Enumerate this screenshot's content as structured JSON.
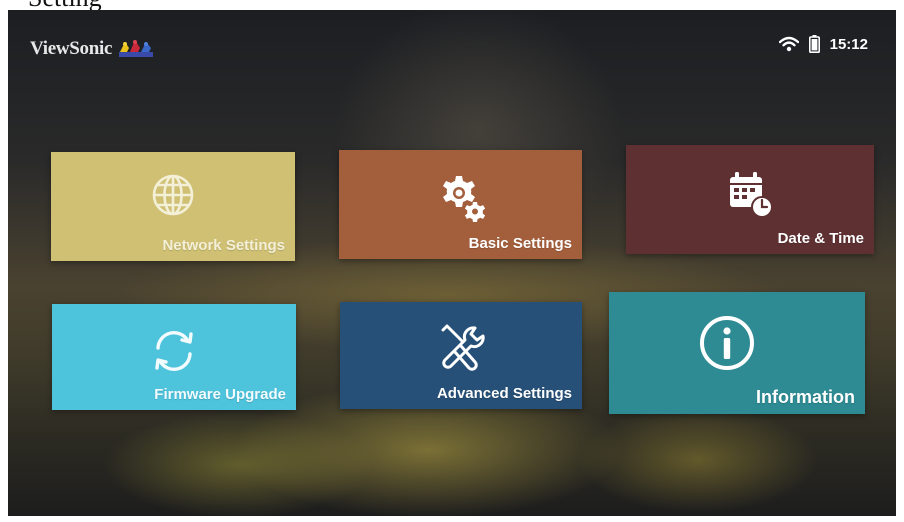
{
  "caption": "Setting",
  "brand": {
    "name": "ViewSonic",
    "logo_icon": "three-birds-logo-icon"
  },
  "status_bar": {
    "wifi_icon": "wifi-icon",
    "battery_icon": "battery-icon",
    "time": "15:12"
  },
  "tiles": [
    {
      "label": "Network Settings",
      "icon": "globe-icon",
      "color": "#cfc074"
    },
    {
      "label": "Basic Settings",
      "icon": "gear-icon",
      "color": "#a35f3c"
    },
    {
      "label": "Date & Time",
      "icon": "calendar-clock-icon",
      "color": "#5e3032"
    },
    {
      "label": "Firmware Upgrade",
      "icon": "refresh-icon",
      "color": "#4ec3dc"
    },
    {
      "label": "Advanced Settings",
      "icon": "tools-icon",
      "color": "#265077"
    },
    {
      "label": "Information",
      "icon": "info-icon",
      "color": "#2e8b93"
    }
  ]
}
